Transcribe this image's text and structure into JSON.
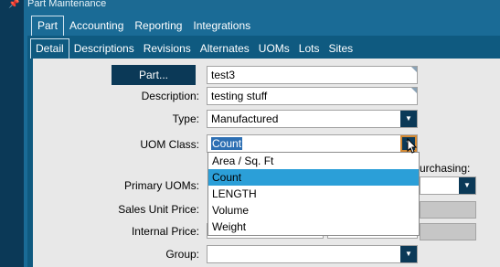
{
  "window": {
    "title": "Part Maintenance",
    "pin_icon": "pin-icon"
  },
  "top_tabs": [
    {
      "label": "Part",
      "active": true
    },
    {
      "label": "Accounting",
      "active": false
    },
    {
      "label": "Reporting",
      "active": false
    },
    {
      "label": "Integrations",
      "active": false
    }
  ],
  "sub_tabs": [
    {
      "label": "Detail",
      "active": true
    },
    {
      "label": "Descriptions",
      "active": false
    },
    {
      "label": "Revisions",
      "active": false
    },
    {
      "label": "Alternates",
      "active": false
    },
    {
      "label": "UOMs",
      "active": false
    },
    {
      "label": "Lots",
      "active": false
    },
    {
      "label": "Sites",
      "active": false
    }
  ],
  "form": {
    "part_button": "Part...",
    "part_value": "test3",
    "description_label": "Description:",
    "description_value": "testing stuff",
    "type_label": "Type:",
    "type_value": "Manufactured",
    "uom_class_label": "UOM Class:",
    "uom_class_value": "Count",
    "primary_uoms_label": "Primary UOMs:",
    "purchasing_label": "urchasing:",
    "sales_unit_price_label": "Sales Unit Price:",
    "internal_price_label": "Internal Price:",
    "group_label": "Group:",
    "group_value": ""
  },
  "uom_class_options": [
    "Area / Sq. Ft",
    "Count",
    "LENGTH",
    "Volume",
    "Weight"
  ],
  "uom_class_highlighted": "Count",
  "colors": {
    "accent": "#1a6b96",
    "button": "#0b3957",
    "highlight": "#2b9fd8",
    "focus": "#d48a34"
  }
}
